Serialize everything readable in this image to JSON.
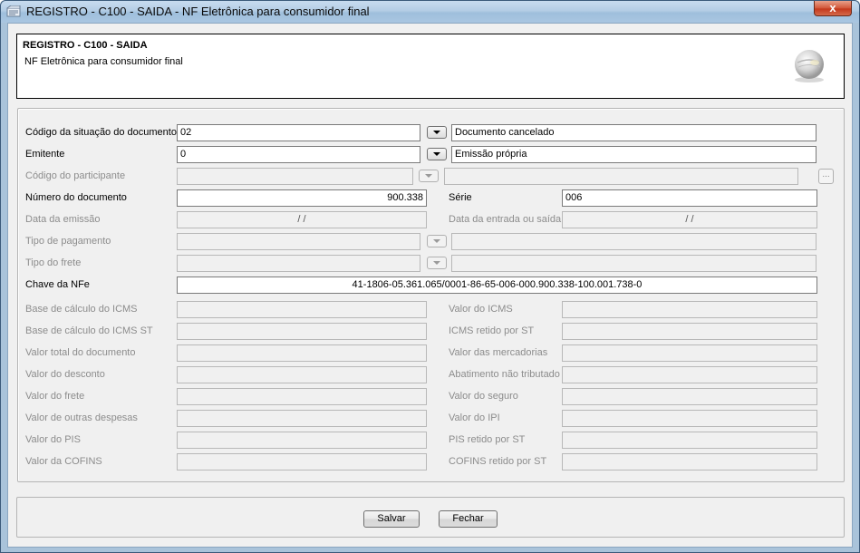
{
  "window": {
    "title": "REGISTRO - C100 - SAIDA - NF Eletrônica para consumidor final",
    "close_label": "x"
  },
  "header": {
    "title": "REGISTRO - C100 - SAIDA",
    "subtitle": "NF Eletrônica para consumidor final"
  },
  "form": {
    "situacao": {
      "label": "Código da situação do documento",
      "value": "02",
      "description": "Documento cancelado"
    },
    "emitente": {
      "label": "Emitente",
      "value": "0",
      "description": "Emissão própria"
    },
    "participante": {
      "label": "Código do participante",
      "value": "",
      "description": "",
      "lookup_label": "..."
    },
    "numero": {
      "label": "Número do documento",
      "value": "900.338"
    },
    "serie": {
      "label": "Série",
      "value": "006"
    },
    "data_emissao": {
      "label": "Data da emissão",
      "value": "/ /"
    },
    "data_entrada": {
      "label": "Data da entrada ou saída",
      "value": "/ /"
    },
    "tipo_pagamento": {
      "label": "Tipo de pagamento",
      "value": "",
      "description": ""
    },
    "tipo_frete": {
      "label": "Tipo do frete",
      "value": "",
      "description": ""
    },
    "chave_nfe": {
      "label": "Chave da NFe",
      "value": "41-1806-05.361.065/0001-86-65-006-000.900.338-100.001.738-0"
    },
    "left_column": [
      {
        "label": "Base de cálculo do ICMS",
        "value": ""
      },
      {
        "label": "Base de cálculo do ICMS ST",
        "value": ""
      },
      {
        "label": "Valor total do documento",
        "value": ""
      },
      {
        "label": "Valor do desconto",
        "value": ""
      },
      {
        "label": "Valor do frete",
        "value": ""
      },
      {
        "label": "Valor de outras despesas",
        "value": ""
      },
      {
        "label": "Valor do PIS",
        "value": ""
      },
      {
        "label": "Valor da COFINS",
        "value": ""
      }
    ],
    "right_column": [
      {
        "label": "Valor do ICMS",
        "value": ""
      },
      {
        "label": "ICMS retido por ST",
        "value": ""
      },
      {
        "label": "Valor das mercadorias",
        "value": ""
      },
      {
        "label": "Abatimento não tributado",
        "value": ""
      },
      {
        "label": "Valor do seguro",
        "value": ""
      },
      {
        "label": "Valor do IPI",
        "value": ""
      },
      {
        "label": "PIS retido por ST",
        "value": ""
      },
      {
        "label": "COFINS retido por ST",
        "value": ""
      }
    ]
  },
  "buttons": {
    "save_label": "Salvar",
    "close_label": "Fechar"
  }
}
